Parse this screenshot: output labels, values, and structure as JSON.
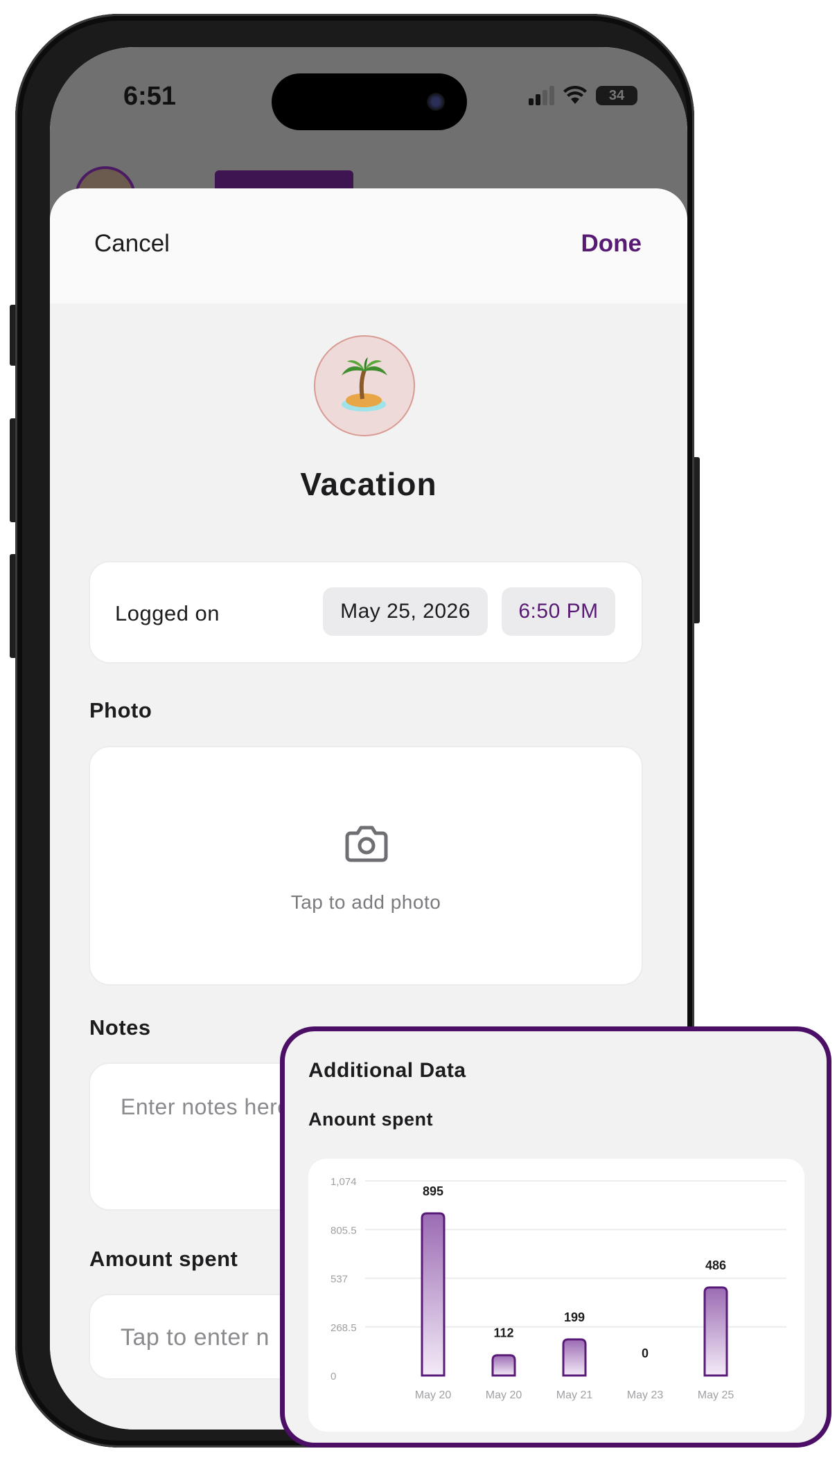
{
  "status_bar": {
    "time": "6:51",
    "battery": "34"
  },
  "sheet": {
    "cancel_label": "Cancel",
    "done_label": "Done",
    "category_icon": "palm-tree-island",
    "title": "Vacation",
    "logged_label": "Logged on",
    "date": "May 25, 2026",
    "time": "6:50 PM",
    "photo_label": "Photo",
    "photo_hint": "Tap to add photo",
    "notes_label": "Notes",
    "notes_placeholder": "Enter notes here",
    "amount_label": "Amount spent",
    "amount_placeholder": "Tap to enter n"
  },
  "overlay": {
    "title": "Additional Data",
    "subtitle": "Anount spent"
  },
  "colors": {
    "accent": "#571b73",
    "overlay_border": "#4b1066",
    "bar_fill": "#9b6bb3"
  },
  "chart_data": {
    "type": "bar",
    "categories": [
      "May 20",
      "May 20",
      "May 21",
      "May 23",
      "May 25"
    ],
    "values": [
      895,
      112,
      199,
      0,
      486
    ],
    "data_labels": [
      "895",
      "112",
      "199",
      "0",
      "486"
    ],
    "yticks": [
      "0",
      "268.5",
      "537",
      "805.5",
      "1,074"
    ],
    "ylim": [
      0,
      1074
    ],
    "grid": true,
    "title": "",
    "xlabel": "",
    "ylabel": ""
  }
}
